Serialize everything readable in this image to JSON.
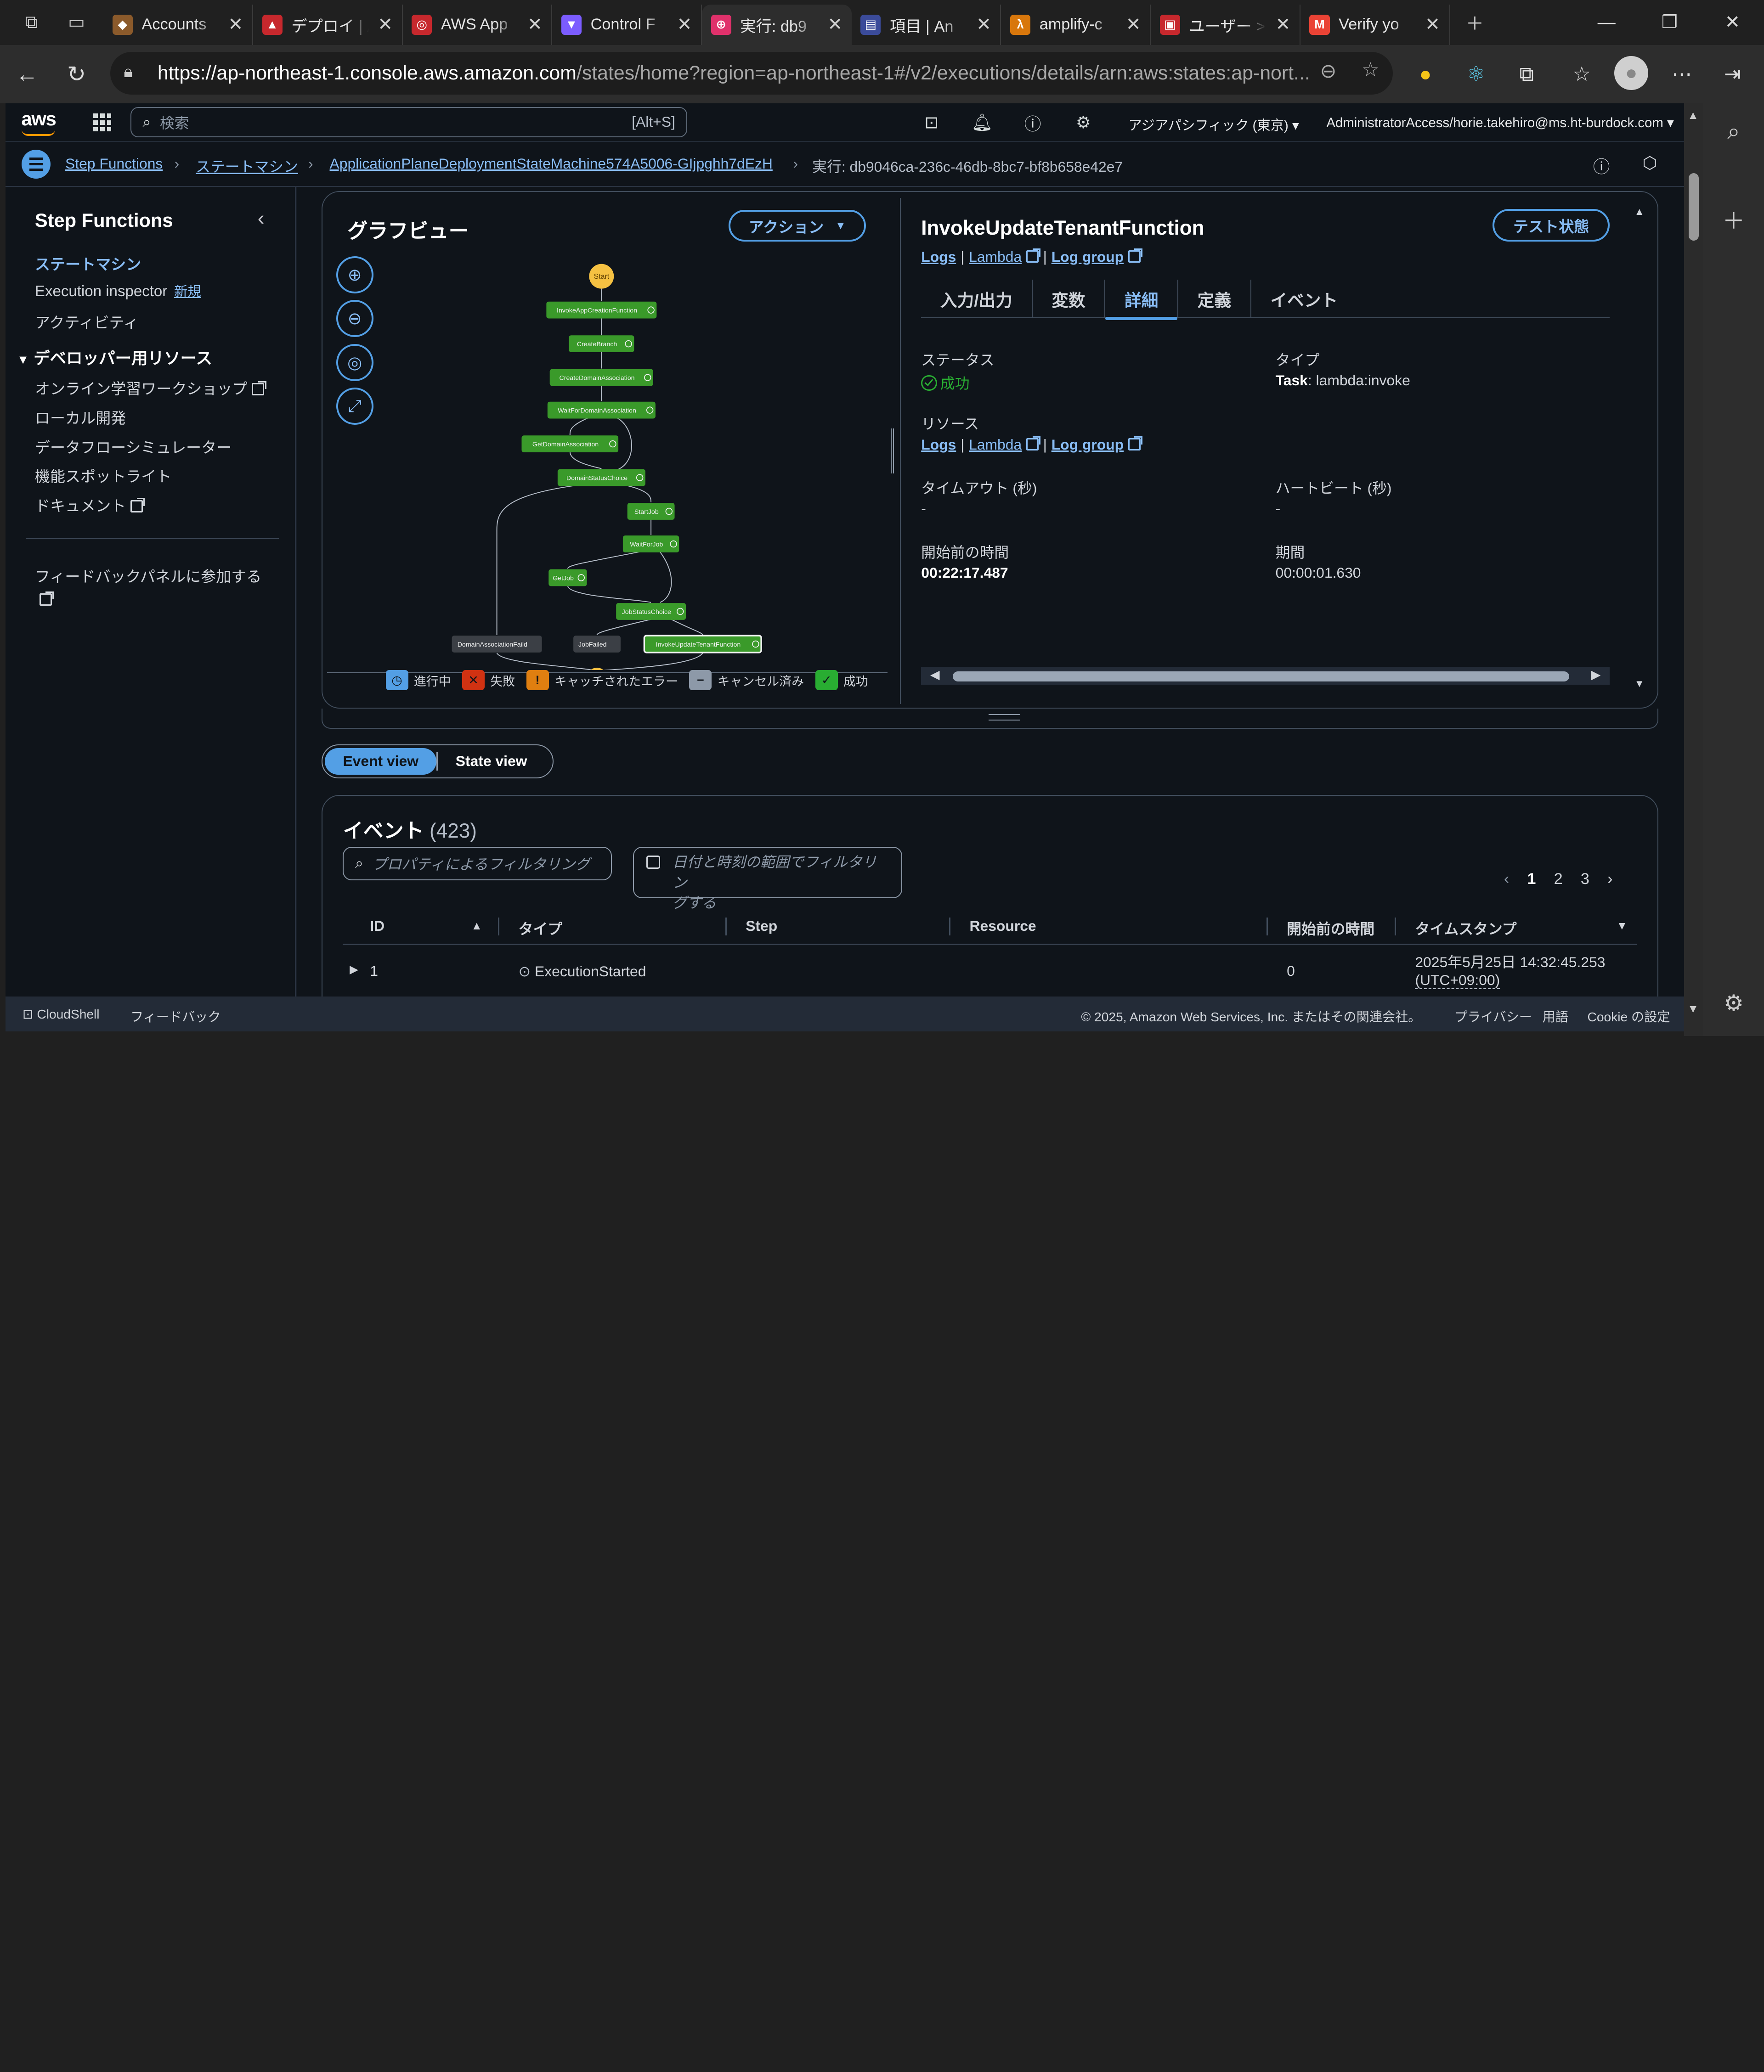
{
  "browser": {
    "tabs": [
      {
        "title": "Accounts",
        "fav_color": "#8b5a2b",
        "fav_glyph": "◆"
      },
      {
        "title": "デプロイ | A",
        "fav_color": "#c7282d",
        "fav_glyph": "▲"
      },
      {
        "title": "AWS App",
        "fav_color": "#c7282d",
        "fav_glyph": "◎"
      },
      {
        "title": "Control F",
        "fav_color": "#7b5cff",
        "fav_glyph": "▼"
      },
      {
        "title": "実行: db9",
        "fav_color": "#e0316b",
        "fav_glyph": "⊕"
      },
      {
        "title": "項目 | An",
        "fav_color": "#3b4b9a",
        "fav_glyph": "▤"
      },
      {
        "title": "amplify-c",
        "fav_color": "#d8770c",
        "fav_glyph": "λ"
      },
      {
        "title": "ユーザー >",
        "fav_color": "#c7282d",
        "fav_glyph": "▣"
      },
      {
        "title": "Verify yo",
        "fav_color": "#ea4335",
        "fav_glyph": "M"
      }
    ],
    "url_host": "https://ap-northeast-1.console.aws.amazon.com",
    "url_rest": "/states/home?region=ap-northeast-1#/v2/executions/details/arn:aws:states:ap-nort..."
  },
  "aws_header": {
    "logo": "aws",
    "search_placeholder": "検索",
    "search_shortcut": "[Alt+S]",
    "region": "アジアパシフィック (東京)",
    "account": "AdministratorAccess/horie.takehiro@ms.ht-burdock.com"
  },
  "breadcrumb": {
    "items": [
      "Step Functions",
      "ステートマシン",
      "ApplicationPlaneDeploymentStateMachine574A5006-GIjpghh7dEzH"
    ],
    "current": "実行: db9046ca-236c-46db-8bc7-bf8b658e42e7"
  },
  "sidebar": {
    "title": "Step Functions",
    "items": [
      {
        "label": "ステートマシン",
        "active": true
      },
      {
        "label": "Execution inspector",
        "badge": "新規"
      },
      {
        "label": "アクティビティ"
      }
    ],
    "section_title": "デベロッパー用リソース",
    "section_items": [
      {
        "label": "オンライン学習ワークショップ",
        "external": true
      },
      {
        "label": "ローカル開発"
      },
      {
        "label": "データフローシミュレーター"
      },
      {
        "label": "機能スポットライト"
      },
      {
        "label": "ドキュメント",
        "external": true
      }
    ],
    "feedback_label": "フィードバックパネルに参加する"
  },
  "graph": {
    "title": "グラフビュー",
    "action_label": "アクション",
    "nodes": [
      {
        "label": "Start",
        "status": "start"
      },
      {
        "label": "InvokeAppCreationFunction",
        "status": "success"
      },
      {
        "label": "CreateBranch",
        "status": "success"
      },
      {
        "label": "CreateDomainAssociation",
        "status": "success"
      },
      {
        "label": "WaitForDomainAssociation",
        "status": "success"
      },
      {
        "label": "GetDomainAssociation",
        "status": "success"
      },
      {
        "label": "DomainStatusChoice",
        "status": "success"
      },
      {
        "label": "StartJob",
        "status": "success"
      },
      {
        "label": "WaitForJob",
        "status": "success"
      },
      {
        "label": "GetJob",
        "status": "success"
      },
      {
        "label": "JobStatusChoice",
        "status": "success"
      },
      {
        "label": "DomainAssociationFaild",
        "status": "not-run"
      },
      {
        "label": "JobFailed",
        "status": "not-run"
      },
      {
        "label": "InvokeUpdateTenantFunction",
        "status": "success-selected"
      }
    ],
    "legend": [
      {
        "label": "進行中",
        "color": "#539fe5",
        "glyph": "◷"
      },
      {
        "label": "失敗",
        "color": "#d13212",
        "glyph": "✕"
      },
      {
        "label": "キャッチされたエラー",
        "color": "#e07f10",
        "glyph": "!"
      },
      {
        "label": "キャンセル済み",
        "color": "#8d99a8",
        "glyph": "−"
      },
      {
        "label": "成功",
        "color": "#29ad32",
        "glyph": "✓"
      }
    ]
  },
  "detail": {
    "title": "InvokeUpdateTenantFunction",
    "test_button": "テスト状態",
    "links": [
      "Logs",
      "Lambda",
      "Log group"
    ],
    "tabs": [
      "入力/出力",
      "変数",
      "詳細",
      "定義",
      "イベント"
    ],
    "active_tab": "詳細",
    "status_label": "ステータス",
    "status_value": "成功",
    "type_label": "タイプ",
    "type_key": "Task",
    "type_value": ": lambda:invoke",
    "resource_label": "リソース",
    "timeout_label": "タイムアウト (秒)",
    "timeout_value": "-",
    "heartbeat_label": "ハートビート (秒)",
    "heartbeat_value": "-",
    "start_label": "開始前の時間",
    "start_value": "00:22:17.487",
    "duration_label": "期間",
    "duration_value": "00:00:01.630"
  },
  "view_toggle": {
    "event": "Event view",
    "state": "State view"
  },
  "events": {
    "title": "イベント",
    "count": "(423)",
    "filter_placeholder": "プロパティによるフィルタリング",
    "date_filter_line1": "日付と時刻の範囲でフィルタリン",
    "date_filter_line2": "グする",
    "pages": [
      "1",
      "2",
      "3"
    ],
    "columns": [
      "ID",
      "タイプ",
      "Step",
      "Resource",
      "開始前の時間",
      "タイムスタンプ"
    ],
    "rows": [
      {
        "id": "1",
        "type": "ExecutionStarted",
        "step": "",
        "resource": "",
        "elapsed": "0",
        "timestamp": "2025年5月25日 14:32:45.253",
        "tz": "(UTC+09:00)"
      }
    ]
  },
  "footer": {
    "cloudshell": "CloudShell",
    "feedback": "フィードバック",
    "copyright": "© 2025, Amazon Web Services, Inc. またはその関連会社。",
    "privacy": "プライバシー",
    "terms": "用語",
    "cookie": "Cookie の設定"
  }
}
